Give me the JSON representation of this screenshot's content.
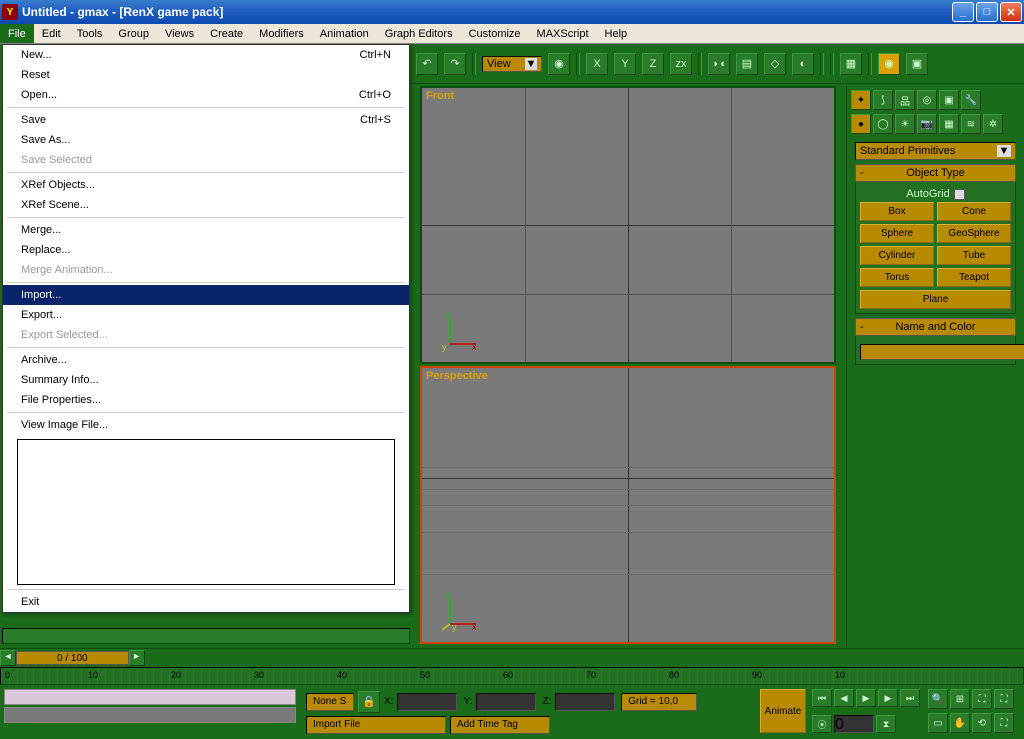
{
  "title": "Untitled - gmax - [RenX game pack]",
  "menus": [
    "File",
    "Edit",
    "Tools",
    "Group",
    "Views",
    "Create",
    "Modifiers",
    "Animation",
    "Graph Editors",
    "Customize",
    "MAXScript",
    "Help"
  ],
  "file_menu": {
    "items": [
      {
        "label": "New...",
        "shortcut": "Ctrl+N",
        "type": "i"
      },
      {
        "label": "Reset",
        "shortcut": "",
        "type": "i"
      },
      {
        "label": "Open...",
        "shortcut": "Ctrl+O",
        "type": "i"
      },
      {
        "type": "sep"
      },
      {
        "label": "Save",
        "shortcut": "Ctrl+S",
        "type": "i"
      },
      {
        "label": "Save As...",
        "shortcut": "",
        "type": "i"
      },
      {
        "label": "Save Selected",
        "shortcut": "",
        "type": "i",
        "disabled": true
      },
      {
        "type": "sep"
      },
      {
        "label": "XRef Objects...",
        "shortcut": "",
        "type": "i"
      },
      {
        "label": "XRef Scene...",
        "shortcut": "",
        "type": "i"
      },
      {
        "type": "sep"
      },
      {
        "label": "Merge...",
        "shortcut": "",
        "type": "i"
      },
      {
        "label": "Replace...",
        "shortcut": "",
        "type": "i"
      },
      {
        "label": "Merge Animation...",
        "shortcut": "",
        "type": "i",
        "disabled": true
      },
      {
        "type": "sep"
      },
      {
        "label": "Import...",
        "shortcut": "",
        "type": "i",
        "highlighted": true
      },
      {
        "label": "Export...",
        "shortcut": "",
        "type": "i"
      },
      {
        "label": "Export Selected...",
        "shortcut": "",
        "type": "i",
        "disabled": true
      },
      {
        "type": "sep"
      },
      {
        "label": "Archive...",
        "shortcut": "",
        "type": "i"
      },
      {
        "label": "Summary Info...",
        "shortcut": "",
        "type": "i"
      },
      {
        "label": "File Properties...",
        "shortcut": "",
        "type": "i"
      },
      {
        "type": "sep"
      },
      {
        "label": "View Image File...",
        "shortcut": "",
        "type": "i"
      },
      {
        "type": "recent"
      },
      {
        "type": "sep"
      },
      {
        "label": "Exit",
        "shortcut": "",
        "type": "i"
      }
    ]
  },
  "toolbar": {
    "view_label": "View"
  },
  "viewports": {
    "front": "Front",
    "perspective": "Perspective"
  },
  "cmdpanel": {
    "dropdown": "Standard Primitives",
    "object_type_head": "Object Type",
    "autogrid": "AutoGrid",
    "buttons": [
      "Box",
      "Cone",
      "Sphere",
      "GeoSphere",
      "Cylinder",
      "Tube",
      "Torus",
      "Teapot",
      "Plane"
    ],
    "name_color_head": "Name and Color"
  },
  "timeline": {
    "frame_display": "0 / 100",
    "ticks": [
      "0",
      "10",
      "20",
      "30",
      "40",
      "50",
      "60",
      "70",
      "80",
      "90",
      "10"
    ]
  },
  "status": {
    "object_sel": "None S",
    "x_label": "X:",
    "y_label": "Y:",
    "z_label": "Z:",
    "grid": "Grid = 10,0",
    "import_file": "Import File",
    "add_time_tag": "Add Time Tag",
    "animate": "Animate",
    "frame_spin": "0"
  }
}
